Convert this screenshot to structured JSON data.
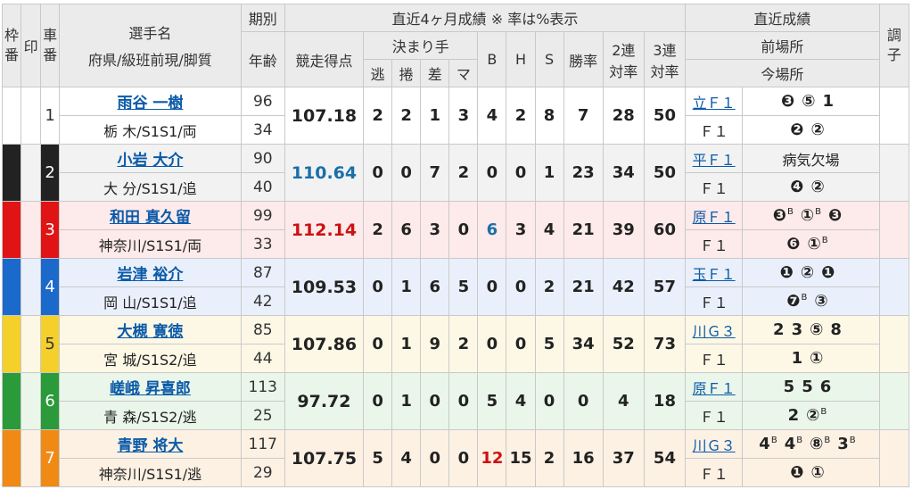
{
  "header": {
    "waku": "枠番",
    "shirushi": "印",
    "car": "車番",
    "player_name": "選手名",
    "player_sub": "府県/級班前現/脚質",
    "term": "期別",
    "age": "年齢",
    "recent4m": "直近4ヶ月成績 ※ 率は%表示",
    "score": "競走得点",
    "kimarite": "決まり手",
    "nige": "逃",
    "makuri": "捲",
    "sashi": "差",
    "mark": "マ",
    "b": "B",
    "h": "H",
    "s": "S",
    "win_rate": "勝率",
    "rentai2a": "2連",
    "rentai2b": "対率",
    "rentai3a": "3連",
    "rentai3b": "対率",
    "recent_results": "直近成績",
    "prev_venue": "前場所",
    "cur_venue": "今場所",
    "condition": "調子"
  },
  "colors": {
    "w1": "#ffffff",
    "w2": "#222222",
    "w3": "#e01414",
    "w4": "#1c69cc",
    "w5": "#f5cf2a",
    "w6": "#2a9a3a",
    "w7": "#f08a14",
    "r1": "#ffffff",
    "r2": "#f2f2f2",
    "r3": "#fdeaea",
    "r4": "#eaf0fb",
    "r5": "#fdf8e6",
    "r6": "#eaf6ea",
    "r7": "#fdf1e4"
  },
  "riders": [
    {
      "waku": "",
      "car": "1",
      "name": "雨谷 一樹",
      "affil": "栃 木/S1S1/両",
      "term": "96",
      "age": "34",
      "score": "107.18",
      "nige": "2",
      "makuri": "2",
      "sashi": "1",
      "mark": "3",
      "b": "4",
      "h": "2",
      "s": "8",
      "win": "7",
      "r2": "28",
      "r3": "50",
      "prev_venue": "立Ｆ１",
      "prev_res": [
        "❸",
        "⑤",
        "1"
      ],
      "prev_sup": [
        "",
        "",
        ""
      ],
      "cur_venue": "Ｆ１",
      "cur_res": [
        "❷",
        "②"
      ],
      "cur_sup": [
        "",
        ""
      ]
    },
    {
      "waku": "2",
      "car": "2",
      "name": "小岩 大介",
      "affil": "大 分/S1S1/追",
      "term": "90",
      "age": "40",
      "score": "110.64",
      "nige": "0",
      "makuri": "0",
      "sashi": "7",
      "mark": "2",
      "b": "0",
      "h": "0",
      "s": "1",
      "win": "23",
      "r2": "34",
      "r3": "50",
      "prev_venue": "平Ｆ１",
      "prev_note": "病気欠場",
      "cur_venue": "Ｆ１",
      "cur_res": [
        "❹",
        "②"
      ],
      "cur_sup": [
        "",
        ""
      ]
    },
    {
      "waku": "3",
      "car": "3",
      "name": "和田 真久留",
      "affil": "神奈川/S1S1/両",
      "term": "99",
      "age": "33",
      "score": "112.14",
      "nige": "2",
      "makuri": "6",
      "sashi": "3",
      "mark": "0",
      "b": "6",
      "h": "3",
      "s": "4",
      "win": "21",
      "r2": "39",
      "r3": "60",
      "prev_venue": "原Ｆ１",
      "prev_res": [
        "❸",
        "①",
        "❸"
      ],
      "prev_sup": [
        "B",
        "B",
        ""
      ],
      "cur_venue": "Ｆ１",
      "cur_res": [
        "❻",
        "①"
      ],
      "cur_sup": [
        "",
        "B"
      ]
    },
    {
      "waku": "4",
      "car": "4",
      "name": "岩津 裕介",
      "affil": "岡 山/S1S1/追",
      "term": "87",
      "age": "42",
      "score": "109.53",
      "nige": "0",
      "makuri": "1",
      "sashi": "6",
      "mark": "5",
      "b": "0",
      "h": "0",
      "s": "2",
      "win": "21",
      "r2": "42",
      "r3": "57",
      "prev_venue": "玉Ｆ１",
      "prev_res": [
        "❶",
        "②",
        "❶"
      ],
      "prev_sup": [
        "",
        "",
        ""
      ],
      "cur_venue": "Ｆ１",
      "cur_res": [
        "❼",
        "③"
      ],
      "cur_sup": [
        "B",
        ""
      ]
    },
    {
      "waku": "5",
      "car": "5",
      "name": "大槻 寛徳",
      "affil": "宮 城/S1S2/追",
      "term": "85",
      "age": "44",
      "score": "107.86",
      "nige": "0",
      "makuri": "1",
      "sashi": "9",
      "mark": "2",
      "b": "0",
      "h": "0",
      "s": "5",
      "win": "34",
      "r2": "52",
      "r3": "73",
      "prev_venue": "川Ｇ３",
      "prev_res": [
        "2",
        "3",
        "⑤",
        "8"
      ],
      "prev_sup": [
        "",
        "",
        "",
        ""
      ],
      "cur_venue": "Ｆ１",
      "cur_res": [
        "1",
        "①"
      ],
      "cur_sup": [
        "",
        ""
      ]
    },
    {
      "waku": "6",
      "car": "6",
      "name": "嵯峨 昇喜郎",
      "affil": "青 森/S1S2/逃",
      "term": "113",
      "age": "25",
      "score": "97.72",
      "nige": "0",
      "makuri": "1",
      "sashi": "0",
      "mark": "0",
      "b": "5",
      "h": "4",
      "s": "0",
      "win": "0",
      "r2": "4",
      "r3": "18",
      "prev_venue": "原Ｆ１",
      "prev_res": [
        "5",
        "5",
        "6"
      ],
      "prev_sup": [
        "",
        "",
        ""
      ],
      "cur_venue": "Ｆ１",
      "cur_res": [
        "2",
        "②"
      ],
      "cur_sup": [
        "",
        "B"
      ]
    },
    {
      "waku": "7",
      "car": "7",
      "name": "青野 将大",
      "affil": "神奈川/S1S1/逃",
      "term": "117",
      "age": "29",
      "score": "107.75",
      "nige": "5",
      "makuri": "4",
      "sashi": "0",
      "mark": "0",
      "b": "12",
      "h": "15",
      "s": "2",
      "win": "16",
      "r2": "37",
      "r3": "54",
      "prev_venue": "川Ｇ３",
      "prev_res": [
        "4",
        "4",
        "⑧",
        "3"
      ],
      "prev_sup": [
        "B",
        "B",
        "B",
        "B"
      ],
      "cur_venue": "Ｆ１",
      "cur_res": [
        "❶",
        "①"
      ],
      "cur_sup": [
        "",
        ""
      ]
    }
  ]
}
